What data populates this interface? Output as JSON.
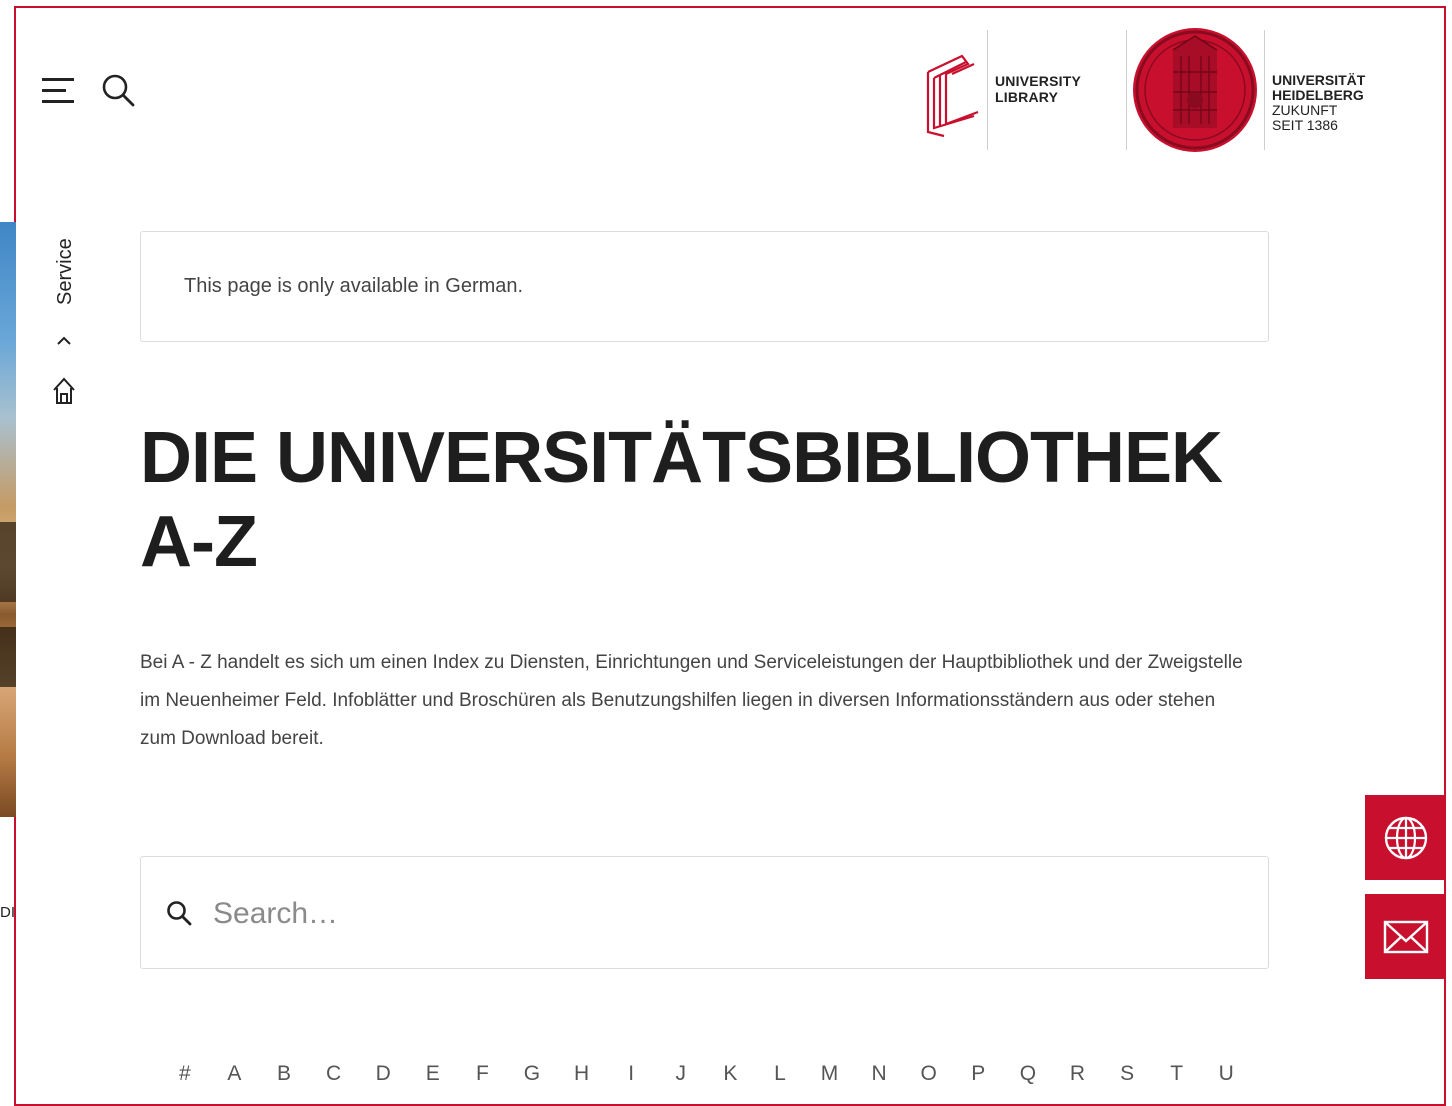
{
  "header": {
    "library_logo_line1": "UNIVERSITY",
    "library_logo_line2": "LIBRARY",
    "university_line1": "UNIVERSITÄT",
    "university_line2": "HEIDELBERG",
    "university_line3": "ZUKUNFT",
    "university_line4": "SEIT 1386"
  },
  "breadcrumb": {
    "current": "Service",
    "home_icon": "home-icon",
    "chevron_icon": "chevron-up-icon"
  },
  "left_cut_text": "DI",
  "notice": "This page is only available in German.",
  "title": "DIE UNIVERSITÄTSBIBLIOTHEK A-Z",
  "intro": "Bei A - Z handelt es sich um einen Index zu Diensten, Einrichtungen und Serviceleistungen der Hauptbibliothek und der Zweigstelle im Neuenheimer Feld. Infoblätter und Broschüren als Benutzungshilfen liegen in diversen Informationsständern aus oder stehen zum Download bereit.",
  "search": {
    "placeholder": "Search…",
    "value": ""
  },
  "alphabet": [
    "#",
    "A",
    "B",
    "C",
    "D",
    "E",
    "F",
    "G",
    "H",
    "I",
    "J",
    "K",
    "L",
    "M",
    "N",
    "O",
    "P",
    "Q",
    "R",
    "S",
    "T",
    "U"
  ],
  "side_buttons": [
    "globe-icon",
    "mail-icon"
  ],
  "colors": {
    "accent": "#c8102e",
    "text": "#222222",
    "muted": "#444444",
    "border": "#dcdcdc"
  }
}
